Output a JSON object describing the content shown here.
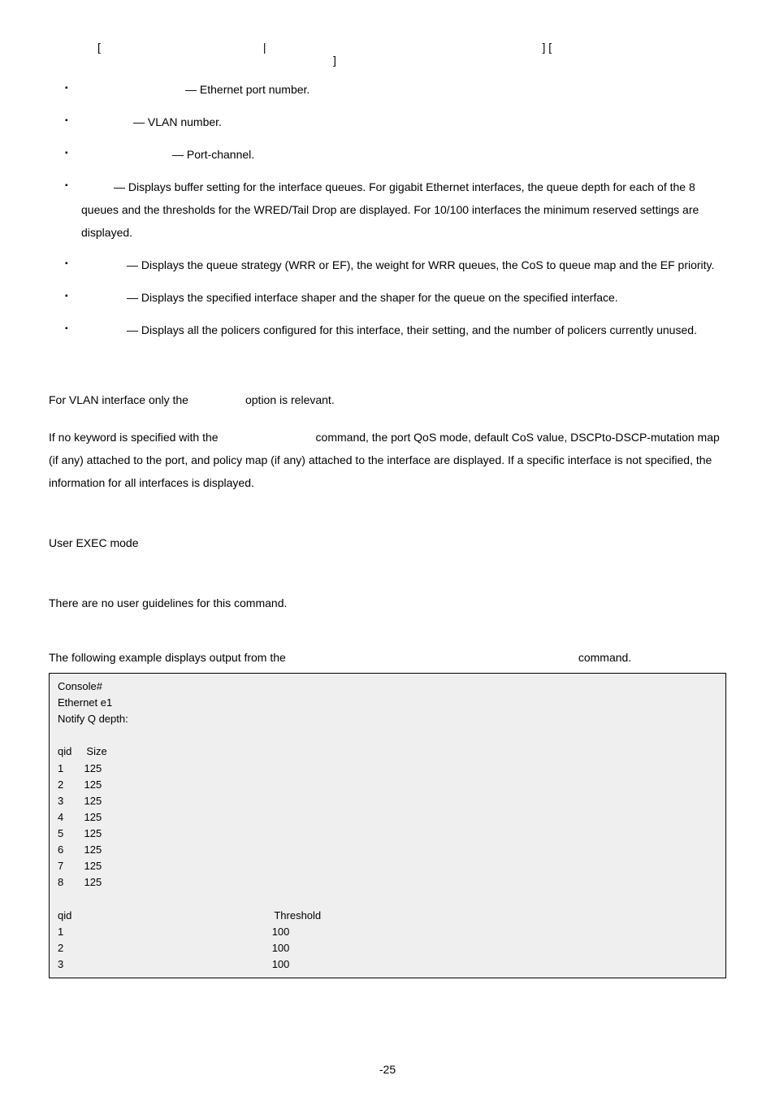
{
  "syntax": {
    "lb1": "[",
    "pipe": "|",
    "rb_lb": "] [",
    "rb2": "]"
  },
  "params": {
    "ethernet": "— Ethernet port number.",
    "vlan": "— VLAN number.",
    "portchannel": "— Port-channel.",
    "buffers": "— Displays buffer setting for the interface queues. For gigabit Ethernet interfaces, the queue depth for each of the 8 queues and the thresholds for the WRED/Tail Drop are displayed. For 10/100 interfaces the minimum reserved settings are displayed.",
    "queueing": "— Displays the queue strategy (WRR or EF), the weight for WRR queues, the CoS to queue map and the EF priority.",
    "shapers": "— Displays the specified interface shaper and the shaper for the queue on the specified interface.",
    "policers": "— Displays all the policers configured for this interface, their setting, and the number of policers currently unused."
  },
  "notes": {
    "vlan_a": "For VLAN interface only the",
    "vlan_b": "option is relevant.",
    "p2a": "If no keyword is specified with the",
    "p2b": "command, the port QoS mode, default CoS value, DSCPto-DSCP-mutation map (if any) attached to the port, and policy map (if any) attached to the interface are displayed. If a specific interface is not specified, the information for all interfaces is displayed."
  },
  "mode": "User EXEC mode",
  "guidelines": "There are no user guidelines for this command.",
  "example_intro_a": "The following example displays output from the",
  "example_intro_b": "command.",
  "console": {
    "l1": "Console#",
    "l2": "Ethernet e1",
    "l3": "Notify Q depth:",
    "h1a": "qid",
    "h1b": "Size",
    "r": [
      {
        "a": "1",
        "b": "125"
      },
      {
        "a": "2",
        "b": "125"
      },
      {
        "a": "3",
        "b": "125"
      },
      {
        "a": "4",
        "b": "125"
      },
      {
        "a": "5",
        "b": "125"
      },
      {
        "a": "6",
        "b": "125"
      },
      {
        "a": "7",
        "b": "125"
      },
      {
        "a": "8",
        "b": "125"
      }
    ],
    "h2a": "qid",
    "h2b": "Threshold",
    "t": [
      {
        "a": "1",
        "b": "100"
      },
      {
        "a": "2",
        "b": "100"
      },
      {
        "a": "3",
        "b": "100"
      }
    ]
  },
  "pagenum": "-25"
}
